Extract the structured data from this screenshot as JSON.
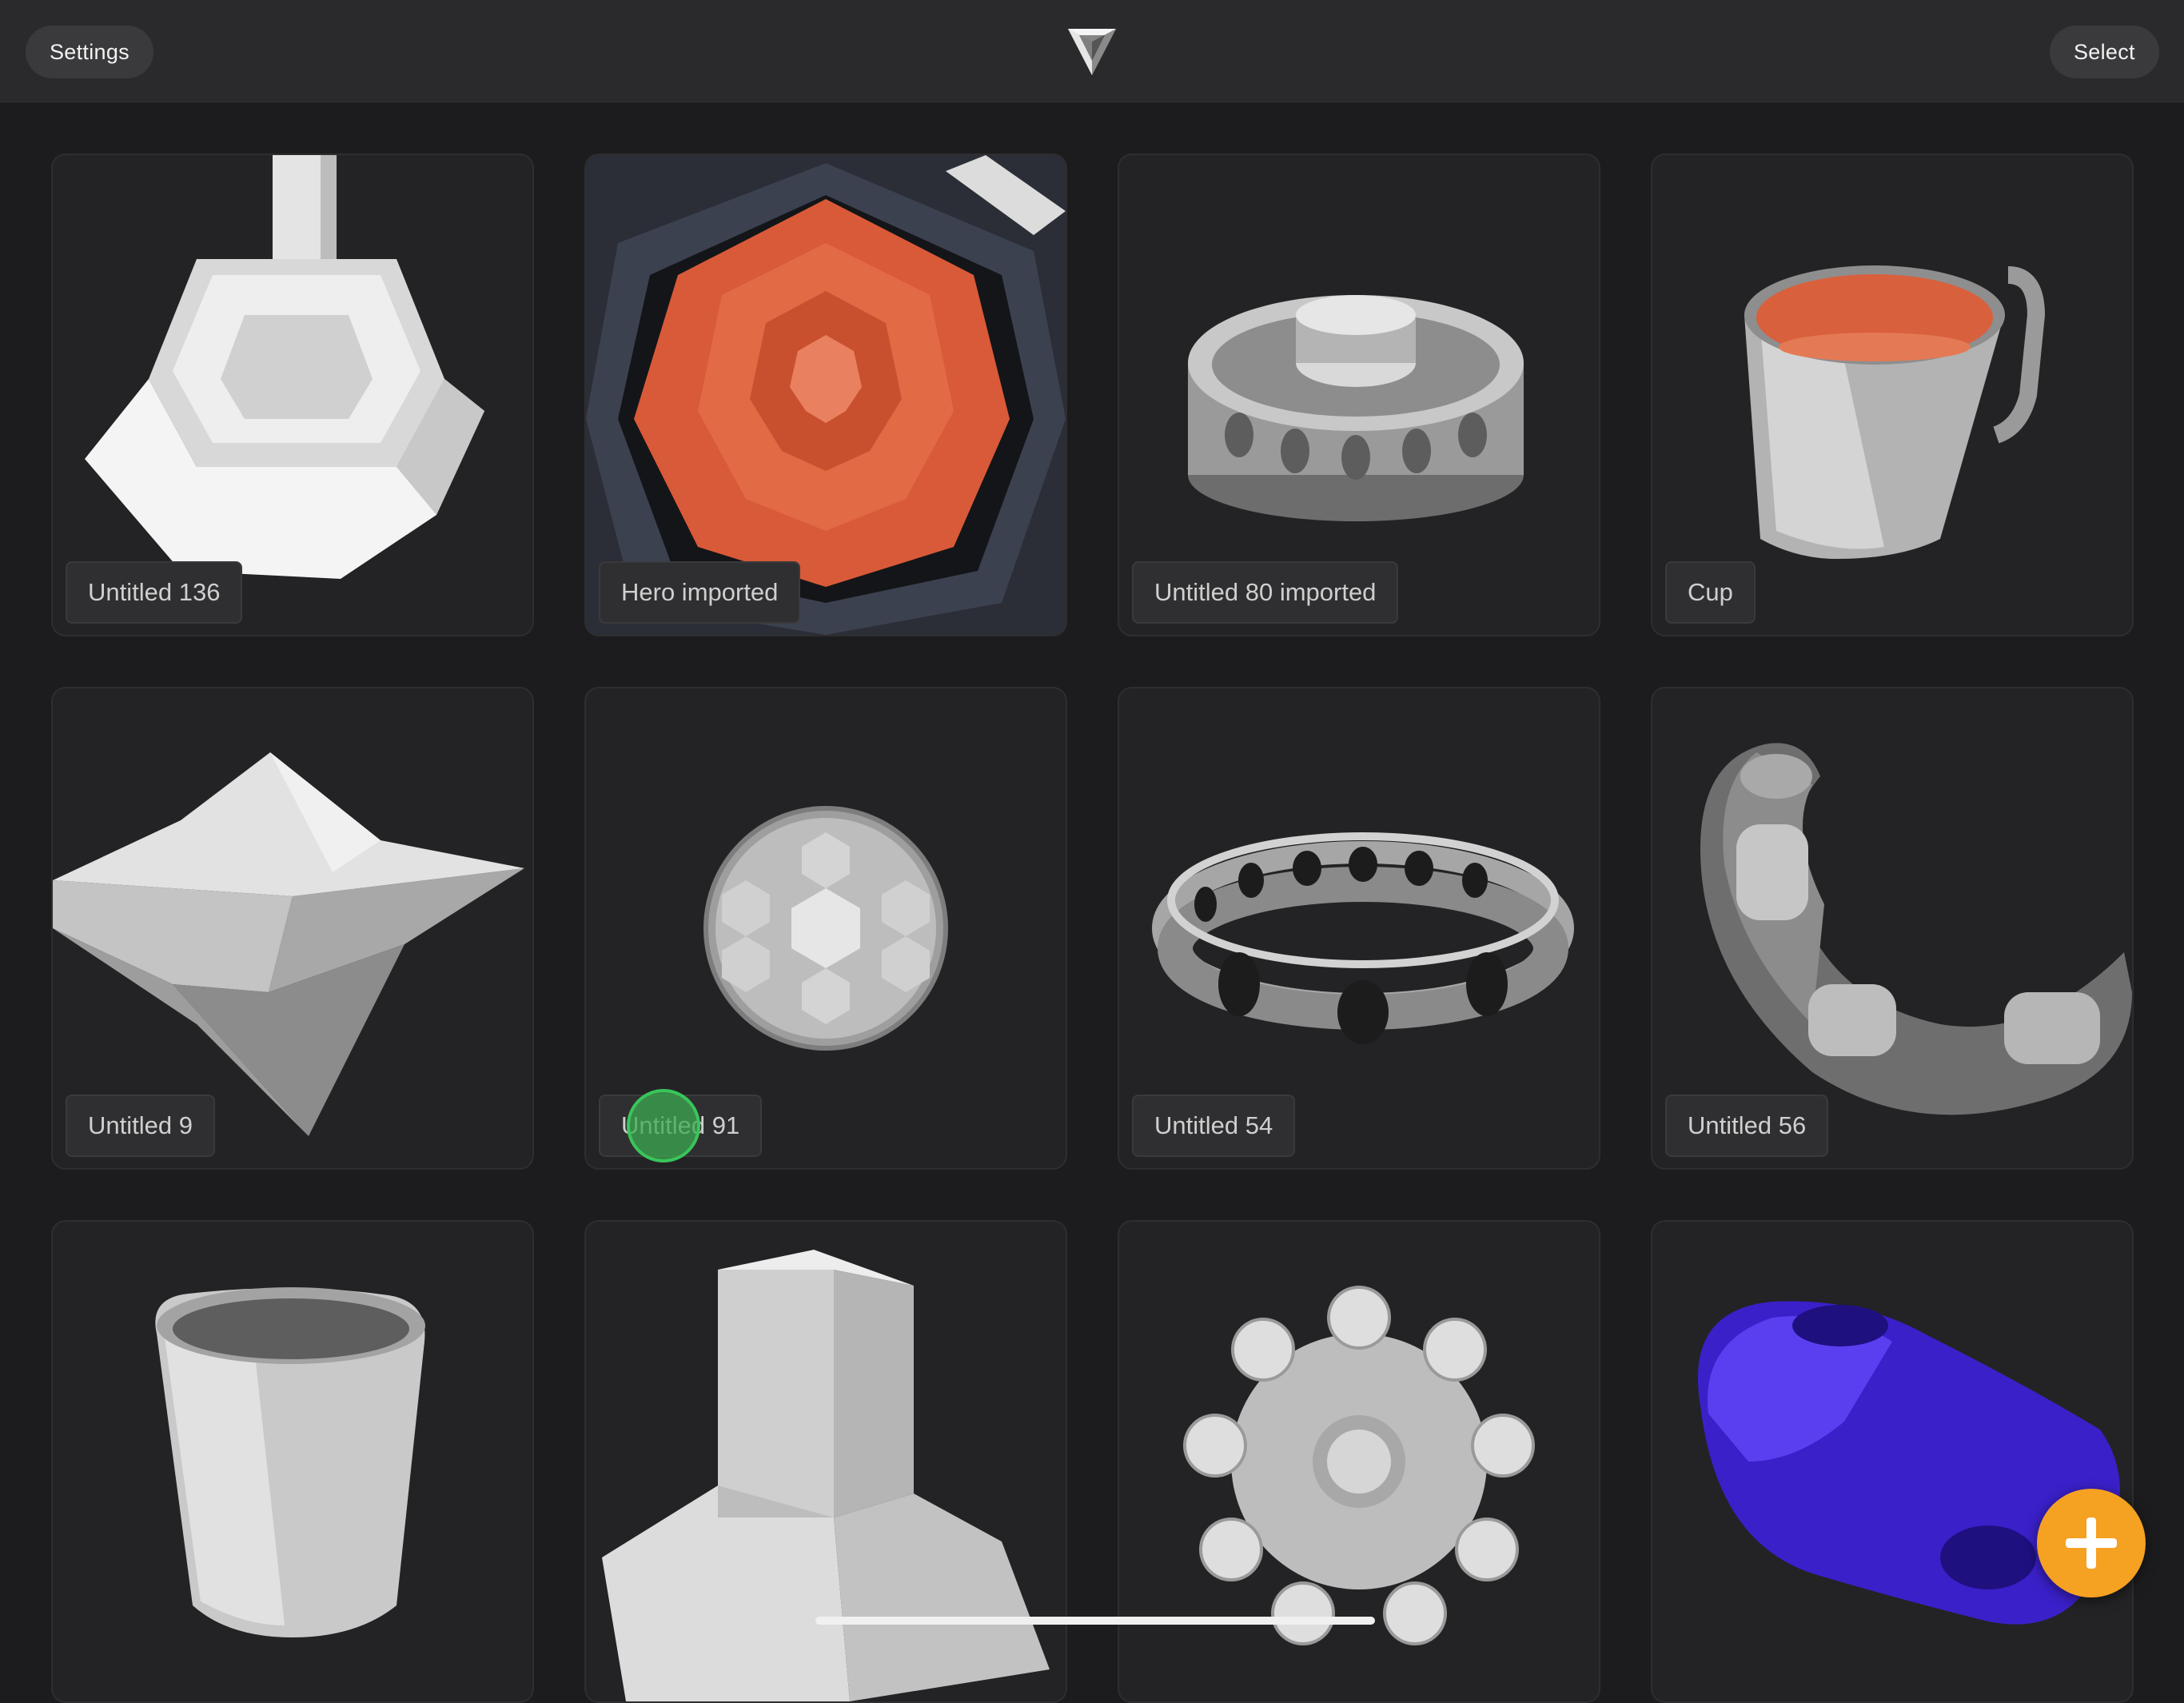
{
  "header": {
    "settings_label": "Settings",
    "select_label": "Select",
    "logo_icon": "nomad-logo-icon"
  },
  "projects": [
    {
      "name": "Untitled 136"
    },
    {
      "name": "Hero imported"
    },
    {
      "name": "Untitled 80 imported"
    },
    {
      "name": "Cup"
    },
    {
      "name": "Untitled 9"
    },
    {
      "name": "Untitled 91"
    },
    {
      "name": "Untitled 54"
    },
    {
      "name": "Untitled 56"
    },
    {
      "name": ""
    },
    {
      "name": ""
    },
    {
      "name": ""
    },
    {
      "name": ""
    }
  ],
  "fab": {
    "icon": "plus-icon"
  },
  "colors": {
    "accent": "#f5a122",
    "background": "#1c1c1e",
    "card": "#232325",
    "touch_indicator": "#39c55a"
  }
}
